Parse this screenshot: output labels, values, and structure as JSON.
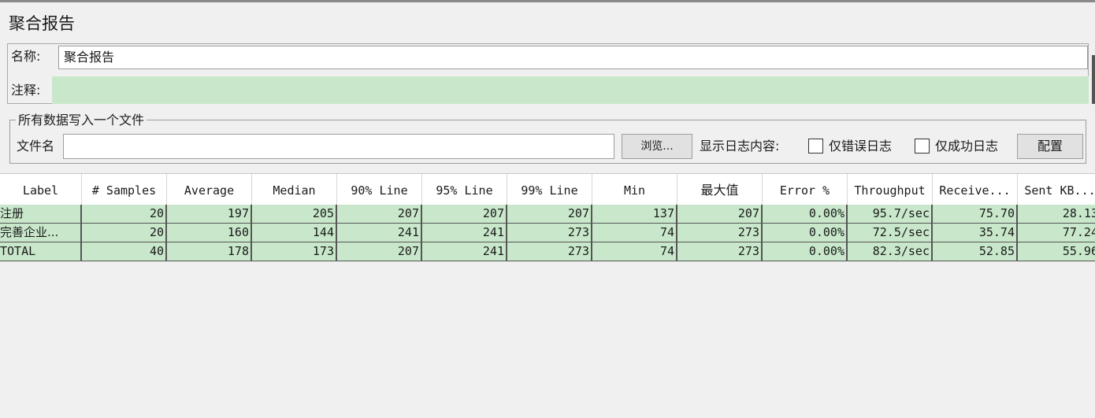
{
  "panel": {
    "title": "聚合报告",
    "name_label": "名称:",
    "name_value": "聚合报告",
    "comment_label": "注释:",
    "comment_value": ""
  },
  "file_group": {
    "legend": "所有数据写入一个文件",
    "filename_label": "文件名",
    "filename_value": "",
    "browse_label": "浏览...",
    "log_label": "显示日志内容:",
    "errors_only_label": "仅错误日志",
    "success_only_label": "仅成功日志",
    "config_label": "配置"
  },
  "table": {
    "columns": [
      "Label",
      "# Samples",
      "Average",
      "Median",
      "90% Line",
      "95% Line",
      "99% Line",
      "Min",
      "最大值",
      "Error %",
      "Throughput",
      "Receive...",
      "Sent KB..."
    ],
    "rows": [
      [
        "注册",
        "20",
        "197",
        "205",
        "207",
        "207",
        "207",
        "137",
        "207",
        "0.00%",
        "95.7/sec",
        "75.70",
        "28.13"
      ],
      [
        "完善企业...",
        "20",
        "160",
        "144",
        "241",
        "241",
        "273",
        "74",
        "273",
        "0.00%",
        "72.5/sec",
        "35.74",
        "77.24"
      ],
      [
        "TOTAL",
        "40",
        "178",
        "173",
        "207",
        "241",
        "273",
        "74",
        "273",
        "0.00%",
        "82.3/sec",
        "52.85",
        "55.96"
      ]
    ]
  }
}
